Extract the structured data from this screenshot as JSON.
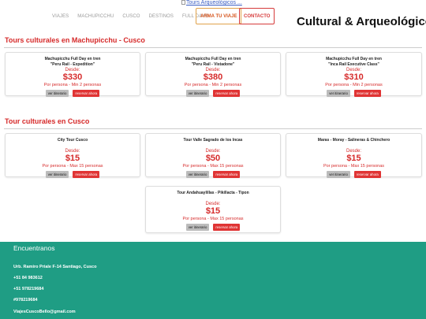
{
  "header": {
    "logo_alt": "Tours Arqueológicos ...",
    "nav": [
      "VIAJES",
      "MACHUPICCHU",
      "CUSCO",
      "DESTINOS",
      "FULL DAYS"
    ],
    "arma_label": "ARMA TU VIAJE",
    "contacto_label": "CONTACTO",
    "brand": "Cultural & Arqueológico"
  },
  "section1": {
    "title": "Tours culturales en Machupicchu - Cusco",
    "cards": [
      {
        "name1": "Machupicchu Full Day en tren",
        "name2": "\"Peru Rail - Expedition\"",
        "from": "Desde:",
        "price": "$330",
        "per": "Por persona - Min 2 personas",
        "itin": "ver itinerario",
        "book": "reservar ahora"
      },
      {
        "name1": "Machupicchu Full Day en tren",
        "name2": "\"Peru Rail - Vistadone\"",
        "from": "Desde:",
        "price": "$380",
        "per": "Por persona - Min 2 personas",
        "itin": "ver itinerario",
        "book": "reservar ahora"
      },
      {
        "name1": "Machupicchu Full Day en tren",
        "name2": "\"Inca Rail Executive Class\"",
        "from": "Desde:",
        "price": "$310",
        "per": "Por persona - Min 2 personas",
        "itin": "ver itinerario",
        "book": "reservar ahora"
      }
    ]
  },
  "section2": {
    "title": "Tour culturales en Cusco",
    "cards": [
      {
        "name": "City Tour Cusco",
        "from": "Desde:",
        "price": "$15",
        "per": "Por persona - Max 15 personas",
        "itin": "ver itinerario",
        "book": "reservar ahora"
      },
      {
        "name": "Tour Valle Sagrado de los Incas",
        "from": "Desde:",
        "price": "$50",
        "per": "Por persona - Max 15 personas",
        "itin": "ver itinerario",
        "book": "reservar ahora"
      },
      {
        "name": "Maras - Moray - Salineras & Chinchero",
        "from": "Desde:",
        "price": "$15",
        "per": "Por persona - Max 15 personas",
        "itin": "ver itinerario",
        "book": "reservar ahora"
      },
      {
        "name": "Tour Andahuaylillas - Pikillacta - Tipon",
        "from": "Desde:",
        "price": "$15",
        "per": "Por persona - Max 15 personas",
        "itin": "ver itinerario",
        "book": "reservar ahora"
      }
    ]
  },
  "footer": {
    "title": "Encuentranos",
    "address": "Urb. Ramiro Priale F-14 Santiago, Cusco",
    "phone1": "+51 84 983612",
    "phone2": " +51 978219684",
    "phone3": "#978219684",
    "email": "ViajesCuscoBello@gmail.com"
  }
}
